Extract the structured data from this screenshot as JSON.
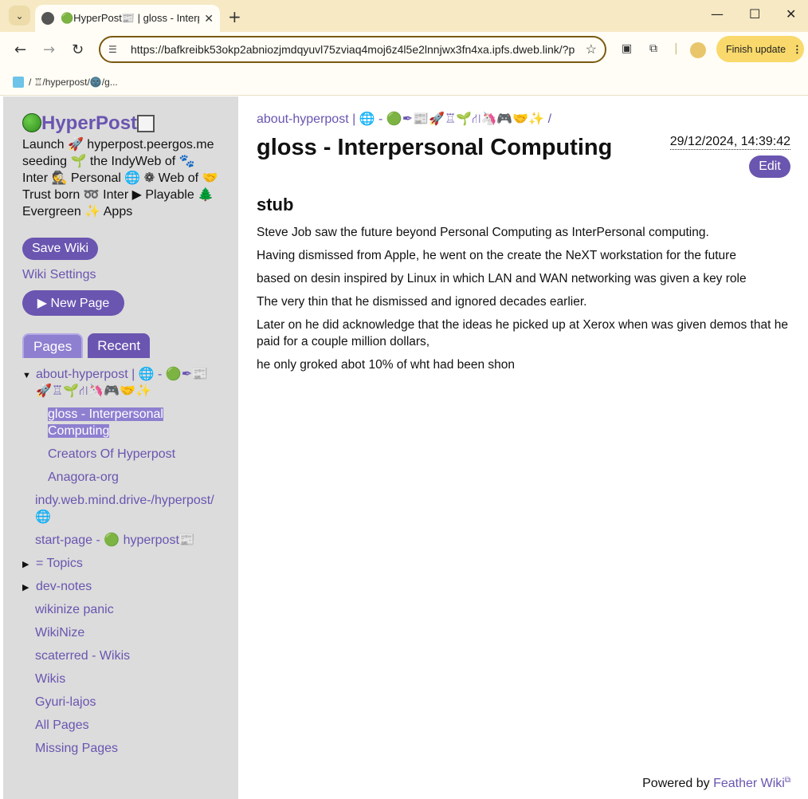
{
  "browser": {
    "tab_title": "🟢HyperPost📰 | gloss - Interp",
    "url": "https://bafkreibk53okp2abniozjmdqyuvl75zviaq4moj6z4l5e2lnnjwx3fn4xa.ipfs.dweb.link/?p",
    "finish_update": "Finish update",
    "bookmark_path": "/ ♖/hyperpost/🌚/g..."
  },
  "sidebar": {
    "site_title": "HyperPost",
    "tagline": "Launch 🚀 hyperpost.peergos.me seeding 🌱 the IndyWeb of 🐾 Inter 🕵 Personal 🌐 ❁ Web of 🤝 Trust born ➿ Inter ▶ Playable 🌲 Evergreen ✨ Apps",
    "save_wiki": "Save Wiki",
    "wiki_settings": "Wiki Settings",
    "new_page": "▶ New Page",
    "tab_pages": "Pages",
    "tab_recent": "Recent",
    "tree": {
      "about": "about-hyperpost | 🌐 - 🟢✒📰 🚀♖🌱⛙🦄🎮🤝✨",
      "gloss": "gloss - Interpersonal Computing",
      "creators": "Creators Of Hyperpost",
      "anagora": "Anagora-org",
      "indy": "indy.web.mind.drive-/hyperpost/ 🌐",
      "start": "start-page - 🟢 hyperpost📰",
      "topics": "= Topics",
      "devnotes": "dev-notes",
      "wikinize_panic": "wikinize panic",
      "wikinize": "WikiNize",
      "scaterred": "scaterred - Wikis",
      "wikis": "Wikis",
      "gyuri": "Gyuri-lajos",
      "all": "All Pages",
      "missing": "Missing Pages"
    }
  },
  "main": {
    "breadcrumb": "about-hyperpost | 🌐 - 🟢✒📰🚀♖🌱⛙🦄🎮🤝✨ /",
    "title": "gloss - Interpersonal Computing",
    "timestamp": "29/12/2024, 14:39:42",
    "edit": "Edit",
    "heading": "stub",
    "paragraphs": [
      "Steve Job saw the future beyond Personal Computing as InterPersonal computing.",
      "Having dismissed from Apple, he went on the create the NeXT workstation for the future",
      "based on desin inspired by Linux in which LAN and WAN networking was given a key role",
      "The very thin that he dismissed and ignored decades earlier.",
      "Later on he did acknowledge that the ideas he picked up at Xerox when was given demos that he paid for a couple million dollars,",
      "he only groked abot 10% of wht had been shon"
    ],
    "footer_prefix": "Powered by ",
    "footer_link": "Feather Wiki"
  },
  "colors": {
    "accent": "#6a55b0",
    "sidebar_bg": "#dcdcdc",
    "tabbar_bg": "#f6e9c4"
  }
}
